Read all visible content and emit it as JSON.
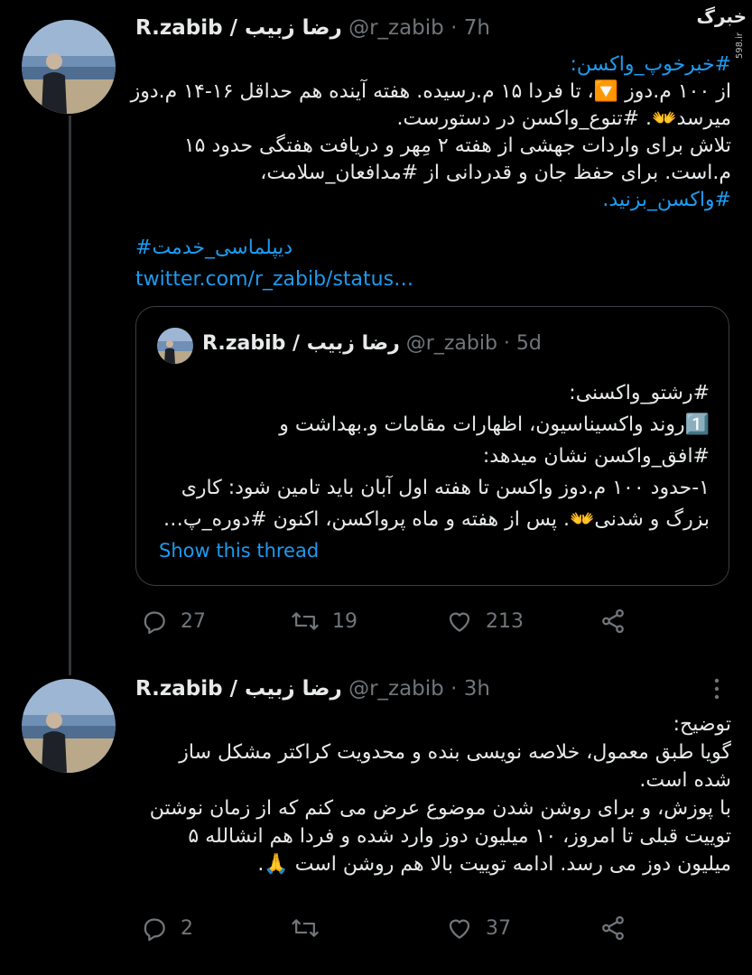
{
  "watermark": {
    "logo": "خبرگ",
    "url": "598.ir"
  },
  "tweet1": {
    "name": "R.zabib / رضا زبیب",
    "handle": "@r_zabib",
    "dot": "·",
    "time": "7h",
    "lines": [
      "#خبرخوپ_واکسن:",
      "از ۱۰۰ م.دوز 🔽، تا فردا ۱۵ م.رسیده. هفته آینده هم حداقل ۱۶-۱۴ م.دوز",
      "میرسد👐. #تنوع_واکسن در دستورست.",
      "تلاش برای واردات جهشی از هفته ۲ مِهر و دریافت هفتگی حدود ۱۵",
      "م.است. برای حفظ جان و قدردانی از #مدافعان_سلامت،",
      "#واکسن_بزنید."
    ],
    "hashtag2": "#دیپلماسی_خدمت",
    "link": "twitter.com/r_zabib/status…",
    "quote": {
      "name": "R.zabib / رضا زبیب",
      "handle": "@r_zabib",
      "dot": "·",
      "time": "5d",
      "lines": [
        "#رشتو_واکسنی:",
        "1️⃣روند واکسیناسیون، اظهارات مقامات و.بهداشت و",
        "#افق_واکسن نشان میدهد:",
        "۱-حدود ۱۰۰ م.دوز واکسن تا هفته اول آبان باید تامین شود: کاری",
        "بزرگ و شدنی👐. پس از هفته و ماه پرواکسن، اکنون #دوره_پ…"
      ],
      "show_thread": "Show this thread"
    },
    "actions": {
      "reply": "27",
      "retweet": "19",
      "like": "213"
    }
  },
  "tweet2": {
    "name": "R.zabib / رضا زبیب",
    "handle": "@r_zabib",
    "dot": "·",
    "time": "3h",
    "lines": [
      "توضیح:",
      "گویا طبق معمول، خلاصه نویسی بنده و محدویت کراکتر مشکل ساز",
      "شده است.",
      "با پوزش، و برای روشن شدن موضوع عرض می کنم که از زمان نوشتن",
      "توییت قبلی تا امروز، ۱۰ میلیون دوز وارد شده و فردا هم انشالله ۵",
      "میلیون دوز می رسد. ادامه توییت بالا هم روشن است 🙏."
    ],
    "actions": {
      "reply": "2",
      "retweet": "",
      "like": "37"
    }
  },
  "colors": {
    "accent": "#1d9bf0",
    "muted": "#71767b",
    "text": "#e7e9ea",
    "background": "#000000"
  },
  "icons": [
    "reply-icon",
    "retweet-icon",
    "like-icon",
    "share-icon",
    "more-icon"
  ]
}
